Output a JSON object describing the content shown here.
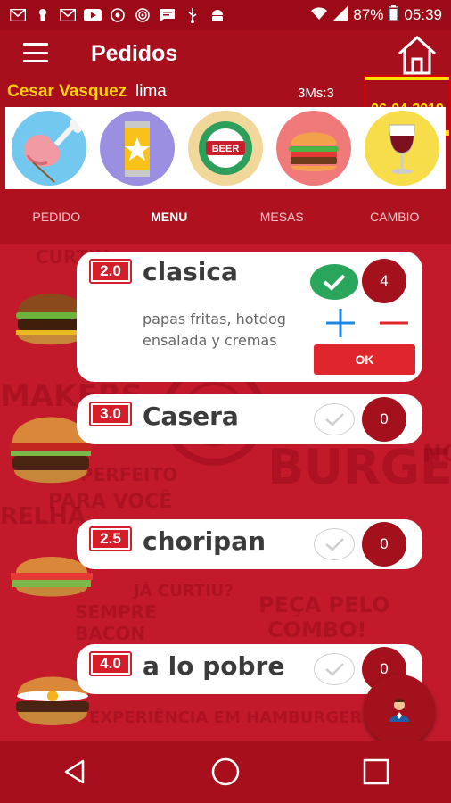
{
  "status_bar": {
    "battery": "87%",
    "time": "05:39"
  },
  "header": {
    "title": "Pedidos",
    "user_name": "Cesar Vasquez",
    "user_city": "lima",
    "mesa_code": "3Ms:3",
    "date": "06-04-2019"
  },
  "categories": [
    {
      "icon": "meat-icon"
    },
    {
      "icon": "soda-can-icon"
    },
    {
      "icon": "beer-cap-icon",
      "label": "BEER"
    },
    {
      "icon": "burger-icon"
    },
    {
      "icon": "wine-glass-icon"
    }
  ],
  "tabs": [
    "PEDIDO",
    "MENU",
    "MESAS",
    "CAMBIO"
  ],
  "active_tab": "MENU",
  "background_words": [
    "CURTIU",
    "BURGERS",
    "PARA VOCÊ",
    "PERFEITO",
    "JÁ CURTIU?",
    "PEÇA PELO",
    "COMBO!",
    "SEMPRE",
    "BACON",
    "EXPERIÊNCIA EM HAMBURGER",
    "NO",
    "RELHA",
    "MAKERS"
  ],
  "products": [
    {
      "price": "2.0",
      "name": "clasica",
      "desc": [
        "papas fritas, hotdog",
        "ensalada y cremas"
      ],
      "qty": "4",
      "selected": true,
      "ok_label": "OK"
    },
    {
      "price": "3.0",
      "name": "Casera",
      "qty": "0",
      "selected": false
    },
    {
      "price": "2.5",
      "name": "choripan",
      "qty": "0",
      "selected": false
    },
    {
      "price": "4.0",
      "name": "a lo pobre",
      "qty": "0",
      "selected": false
    }
  ],
  "colors": {
    "primary": "#a80f1d",
    "accent": "#ffd400",
    "check": "#2aa65c",
    "plus": "#1e88e5",
    "minus": "#e0262d"
  }
}
